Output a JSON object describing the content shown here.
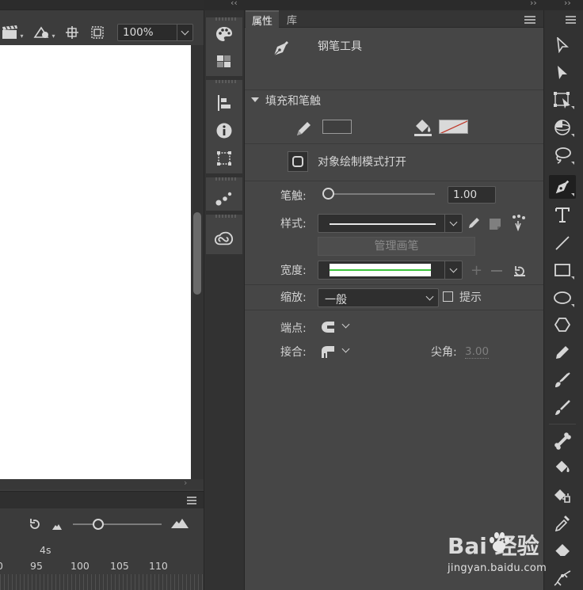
{
  "stage": {
    "zoom": "100%",
    "toolbar_icons": [
      "clapper-icon",
      "symbol-edit-icon",
      "center-stage-icon",
      "clip-stage-icon"
    ]
  },
  "timeline": {
    "ruler_label": "4s",
    "frames": [
      "0",
      "95",
      "100",
      "105",
      "110"
    ]
  },
  "dock": {
    "icons": [
      "color-palette-icon",
      "swatches-icon",
      "align-icon",
      "info-icon",
      "transform-icon",
      "brush-library-icon",
      "creative-cloud-libraries-icon"
    ]
  },
  "properties": {
    "tabs": [
      "属性",
      "库"
    ],
    "tool_name": "钢笔工具",
    "section_title": "填充和笔触",
    "object_draw_label": "对象绘制模式打开",
    "stroke_label": "笔触:",
    "stroke_value": "1.00",
    "style_label": "样式:",
    "manage_brush": "管理画笔",
    "width_label": "宽度:",
    "scale_label": "缩放:",
    "scale_value": "一般",
    "hint_label": "提示",
    "cap_label": "端点:",
    "join_label": "接合:",
    "miter_label": "尖角:",
    "miter_value": "3.00",
    "colors": {
      "stroke": "#3f3f3f",
      "fill": "#d9d9d9",
      "no_color_slash": "#c0392b",
      "width_profile": "#3cc43c"
    }
  },
  "tools": {
    "items": [
      "selection-tool",
      "subselection-tool",
      "free-transform-tool",
      "3d-rotation-tool",
      "lasso-tool",
      "pen-tool",
      "text-tool",
      "line-tool",
      "rectangle-tool",
      "oval-tool",
      "polystar-tool",
      "pencil-tool",
      "paint-brush-tool",
      "brush-tool",
      "bone-tool",
      "paint-bucket-tool",
      "ink-bottle-tool",
      "eyedropper-tool",
      "eraser-tool",
      "width-tool"
    ],
    "active": "pen-tool"
  },
  "watermark": {
    "logo": "Bai 经验",
    "url": "jingyan.baidu.com"
  }
}
